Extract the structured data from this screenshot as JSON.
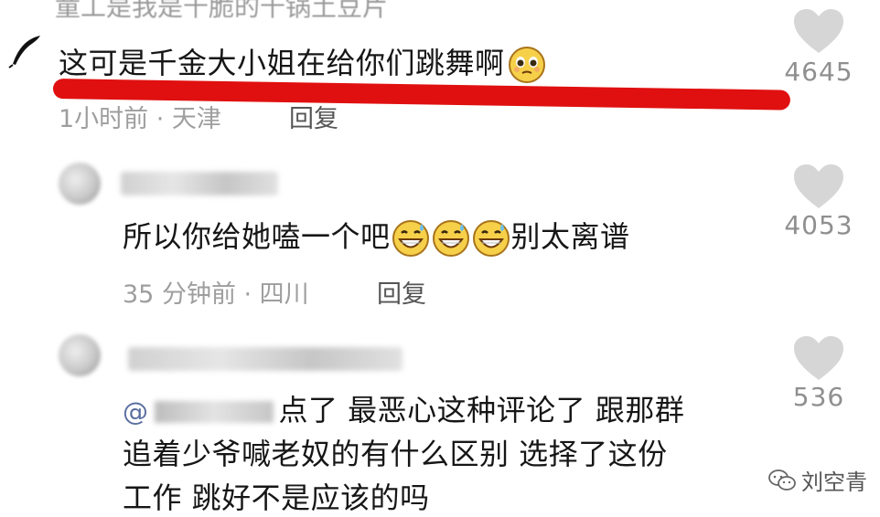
{
  "top_cut": {
    "text": "童工是我是千脆的千锅土豆片"
  },
  "comments": [
    {
      "text": "这可是千金大小姐在给你们跳舞啊",
      "meta": "1小时前 · 天津",
      "reply": "回复",
      "likes": "4645"
    },
    {
      "text": "所以你给她嗑一个吧",
      "text_suffix": "别太离谱",
      "meta": "35 分钟前 · 四川",
      "reply": "回复",
      "likes": "4053"
    },
    {
      "mention": "@",
      "line1": "点了 最恶心这种评论了 跟那群",
      "line2": "追着少爷喊老奴的有什么区别 选择了这份",
      "line3": "工作 跳好不是应该的吗",
      "likes": "536"
    }
  ],
  "watermark": {
    "text": "刘空青",
    "icon": "wechat-icon"
  },
  "colors": {
    "highlight": "#e01010",
    "text": "#161616",
    "meta": "#9e9e9e",
    "heart": "#d6d6d6"
  }
}
